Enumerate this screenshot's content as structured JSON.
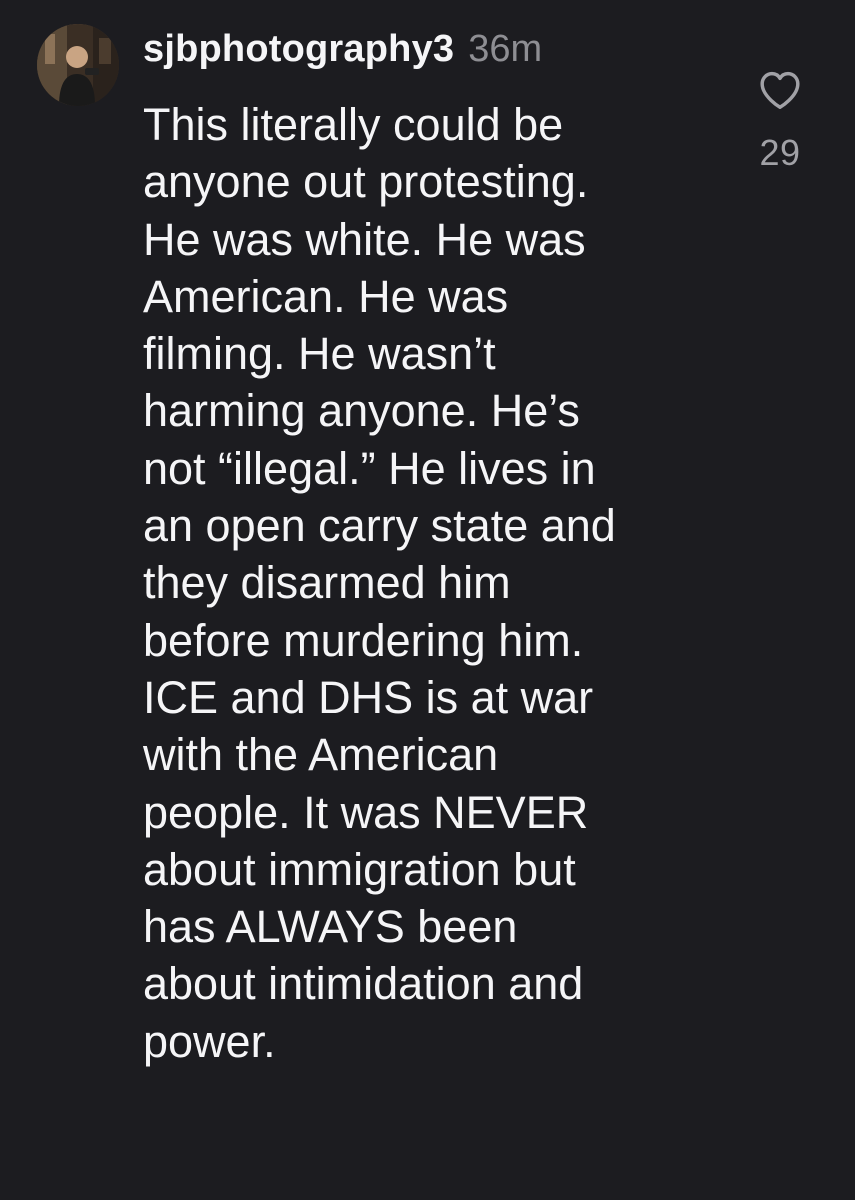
{
  "comment": {
    "username": "sjbphotography3",
    "timestamp": "36m",
    "lines": [
      "This literally could be",
      "anyone out protesting.",
      "He was white. He was",
      "American. He was",
      "filming. He wasn’t",
      "harming anyone. He’s",
      "not “illegal.” He lives in",
      "an open carry state and",
      "they disarmed him",
      "before murdering him.",
      "ICE and DHS is at war",
      "with the American",
      "people. It was NEVER",
      "about immigration but",
      "has ALWAYS been",
      "about intimidation and",
      "power."
    ],
    "like_icon": "heart-outline-icon",
    "like_count": "29"
  },
  "colors": {
    "background": "#1c1c20",
    "text": "#f5f5f7",
    "muted": "#8e8e93",
    "icon": "#a1a1a6"
  }
}
